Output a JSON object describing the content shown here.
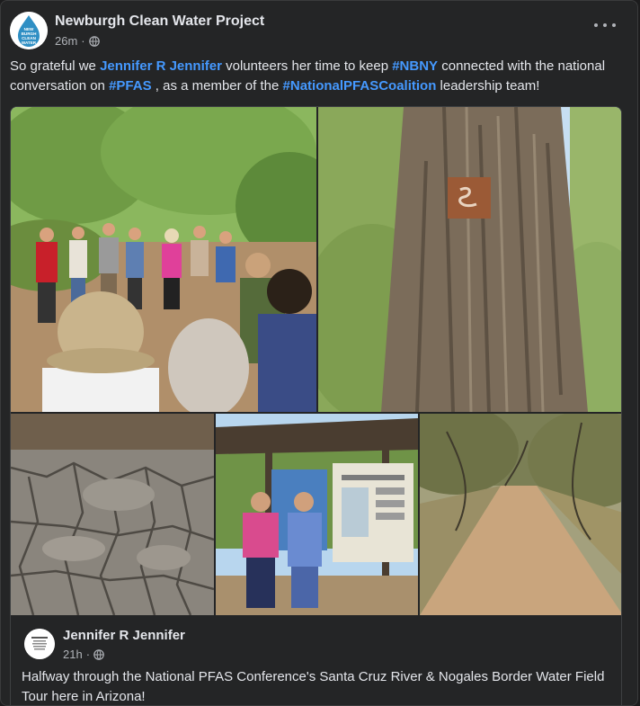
{
  "post": {
    "page_name": "Newburgh Clean Water Project",
    "avatar_text_lines": [
      "NEW",
      "BURGH",
      "CLEAN",
      "WATER"
    ],
    "time": "26m",
    "separator": "·",
    "audience_icon": "globe-icon",
    "more_icon": "more-options-icon",
    "text": {
      "part1": "So grateful we ",
      "mention": "Jennifer R Jennifer",
      "part2": " volunteers her time to keep ",
      "tag1": "#NBNY",
      "part3": " connected with the national conversation on ",
      "tag2": "#PFAS",
      "part4": " , as a member of the ",
      "tag3": "#NationalPFASCoalition",
      "part5": " leadership team!"
    }
  },
  "photos": [
    {
      "name": "photo-group-tour",
      "alt": "Group of people in hats gathered on a dirt trail under trees"
    },
    {
      "name": "photo-tree-trail-marker",
      "alt": "Large cottonwood tree with a brown trail marker sign"
    },
    {
      "name": "photo-cracked-riverbed",
      "alt": "Dry cracked mud on a riverbed"
    },
    {
      "name": "photo-two-women-kiosk",
      "alt": "Two women standing in front of an information kiosk"
    },
    {
      "name": "photo-dirt-trail",
      "alt": "Dirt trail lined with trees"
    }
  ],
  "shared": {
    "author": "Jennifer R Jennifer",
    "time": "21h",
    "separator": "·",
    "audience_icon": "globe-icon",
    "text": "Halfway through the National PFAS Conference's Santa Cruz River & Nogales Border Water Field Tour here in Arizona!"
  },
  "colors": {
    "background": "#242526",
    "text": "#e4e6eb",
    "secondary_text": "#b0b3b8",
    "link": "#4599ff"
  }
}
